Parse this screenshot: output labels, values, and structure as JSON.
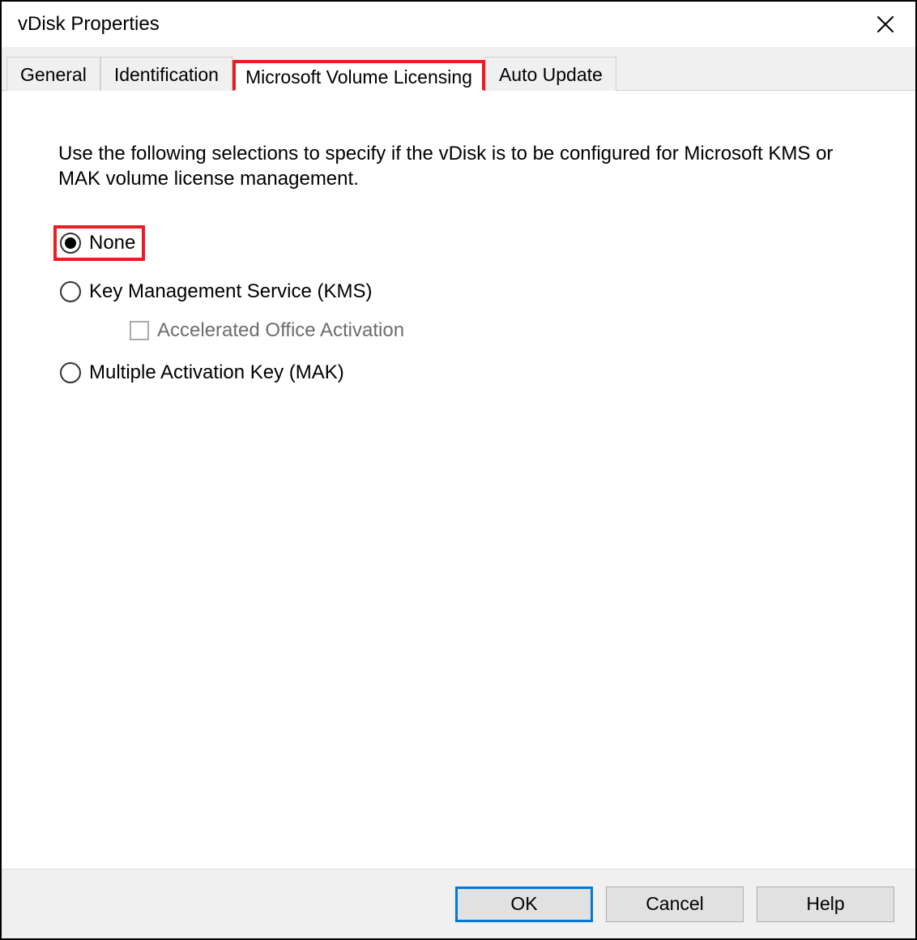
{
  "window": {
    "title": "vDisk Properties"
  },
  "tabs": {
    "general": "General",
    "identification": "Identification",
    "volume_licensing": "Microsoft Volume Licensing",
    "auto_update": "Auto Update"
  },
  "content": {
    "description": "Use the following selections to specify if the vDisk is to be configured for Microsoft KMS or MAK volume license management.",
    "options": {
      "none": "None",
      "kms": "Key Management Service (KMS)",
      "accelerated": "Accelerated Office Activation",
      "mak": "Multiple Activation Key (MAK)"
    }
  },
  "footer": {
    "ok": "OK",
    "cancel": "Cancel",
    "help": "Help"
  }
}
